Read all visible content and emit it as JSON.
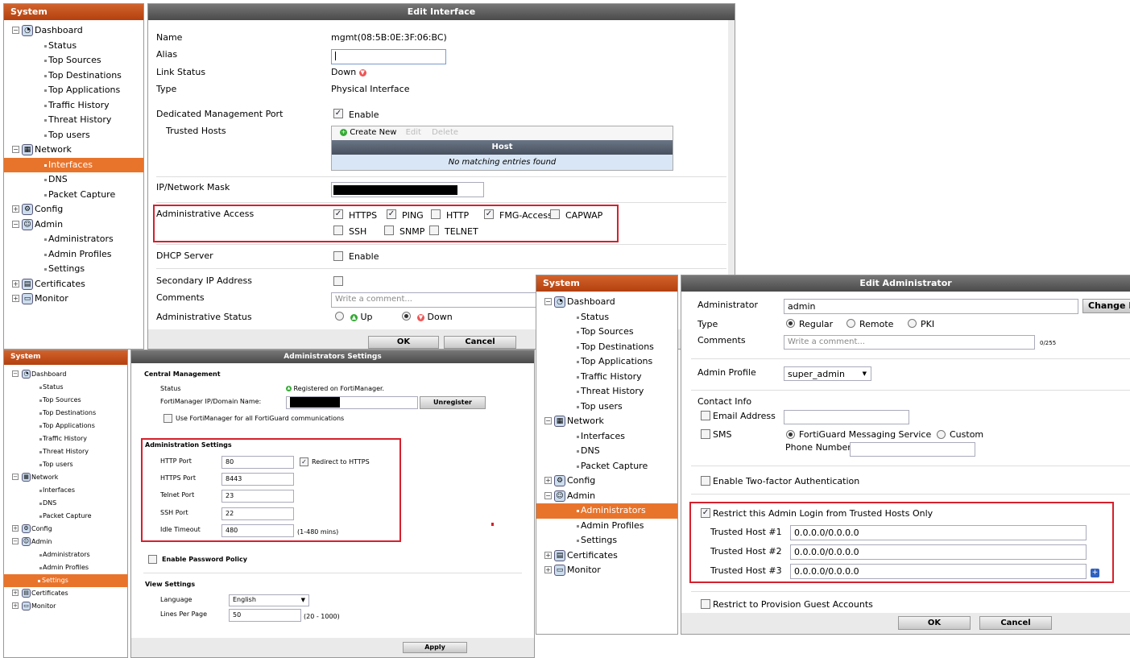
{
  "tree_main": {
    "title": "System",
    "items": [
      {
        "label": "Dashboard",
        "level": 1,
        "icon": "dashboard-icon",
        "glyph": "◔",
        "pm": "⊟"
      },
      {
        "label": "Status",
        "level": 2
      },
      {
        "label": "Top Sources",
        "level": 2
      },
      {
        "label": "Top Destinations",
        "level": 2
      },
      {
        "label": "Top Applications",
        "level": 2
      },
      {
        "label": "Traffic History",
        "level": 2
      },
      {
        "label": "Threat History",
        "level": 2
      },
      {
        "label": "Top users",
        "level": 2
      },
      {
        "label": "Network",
        "level": 1,
        "icon": "network-icon",
        "glyph": "▦",
        "pm": "⊟"
      },
      {
        "label": "Interfaces",
        "level": 2,
        "selected": true
      },
      {
        "label": "DNS",
        "level": 2
      },
      {
        "label": "Packet Capture",
        "level": 2
      },
      {
        "label": "Config",
        "level": 1,
        "icon": "config-icon",
        "glyph": "⚙",
        "pm": "⊞"
      },
      {
        "label": "Admin",
        "level": 1,
        "icon": "admin-icon",
        "glyph": "☺",
        "pm": "⊟"
      },
      {
        "label": "Administrators",
        "level": 2
      },
      {
        "label": "Admin Profiles",
        "level": 2
      },
      {
        "label": "Settings",
        "level": 2
      },
      {
        "label": "Certificates",
        "level": 1,
        "icon": "certificates-icon",
        "glyph": "▤",
        "pm": "⊞"
      },
      {
        "label": "Monitor",
        "level": 1,
        "icon": "monitor-icon",
        "glyph": "▭",
        "pm": "⊞"
      }
    ]
  },
  "tree_small": {
    "title": "System",
    "selected": "Settings"
  },
  "tree_right": {
    "title": "System",
    "selected": "Administrators"
  },
  "edit_interface": {
    "title": "Edit Interface",
    "name_label": "Name",
    "name_value": "mgmt(08:5B:0E:3F:06:BC)",
    "alias_label": "Alias",
    "link_status_label": "Link Status",
    "link_status_value": "Down",
    "type_label": "Type",
    "type_value": "Physical Interface",
    "dedicated_label": "Dedicated Management Port",
    "enable_label": "Enable",
    "trusted_hosts_label": "Trusted Hosts",
    "create_new": "Create New",
    "edit": "Edit",
    "delete": "Delete",
    "host_header": "Host",
    "no_entries": "No matching entries found",
    "ip_mask_label": "IP/Network Mask",
    "admin_access_label": "Administrative Access",
    "access": [
      {
        "label": "HTTPS",
        "checked": true
      },
      {
        "label": "PING",
        "checked": true
      },
      {
        "label": "HTTP",
        "checked": false
      },
      {
        "label": "FMG-Access",
        "checked": true
      },
      {
        "label": "CAPWAP",
        "checked": false
      },
      {
        "label": "SSH",
        "checked": false
      },
      {
        "label": "SNMP",
        "checked": false
      },
      {
        "label": "TELNET",
        "checked": false
      }
    ],
    "dhcp_label": "DHCP Server",
    "dhcp_enable": "Enable",
    "secondary_ip_label": "Secondary IP Address",
    "comments_label": "Comments",
    "comments_placeholder": "Write a comment...",
    "admin_status_label": "Administrative Status",
    "status_up": "Up",
    "status_down": "Down",
    "ok": "OK",
    "cancel": "Cancel"
  },
  "admin_settings": {
    "title": "Administrators Settings",
    "central_mgmt": "Central Management",
    "status_label": "Status",
    "status_value": "Registered on FortiManager.",
    "fmg_ip_label": "FortiManager IP/Domain Name:",
    "unregister": "Unregister",
    "use_fmg": "Use FortiManager for all FortiGuard communications",
    "admin_settings_title": "Administration Settings",
    "http_port_label": "HTTP Port",
    "http_port": "80",
    "redirect_https": "Redirect to HTTPS",
    "https_port_label": "HTTPS Port",
    "https_port": "8443",
    "telnet_port_label": "Telnet Port",
    "telnet_port": "23",
    "ssh_port_label": "SSH Port",
    "ssh_port": "22",
    "idle_timeout_label": "Idle Timeout",
    "idle_timeout": "480",
    "idle_range": "(1-480 mins)",
    "password_policy": "Enable Password Policy",
    "view_settings": "View Settings",
    "language_label": "Language",
    "language": "English",
    "lines_label": "Lines Per Page",
    "lines": "50",
    "lines_range": "(20 - 1000)",
    "apply": "Apply"
  },
  "edit_admin": {
    "title": "Edit Administrator",
    "admin_label": "Administrator",
    "admin_value": "admin",
    "change_btn": "Change P",
    "type_label": "Type",
    "type_regular": "Regular",
    "type_remote": "Remote",
    "type_pki": "PKI",
    "comments_label": "Comments",
    "comments_placeholder": "Write a comment...",
    "comments_count": "0/255",
    "profile_label": "Admin Profile",
    "profile_value": "super_admin",
    "contact_info": "Contact Info",
    "email_label": "Email Address",
    "sms_label": "SMS",
    "fortiguard_msg": "FortiGuard Messaging Service",
    "custom": "Custom",
    "phone_label": "Phone Number",
    "two_factor": "Enable Two-factor Authentication",
    "restrict_trusted": "Restrict this Admin Login from Trusted Hosts Only",
    "trusted": [
      {
        "label": "Trusted Host #1",
        "value": "0.0.0.0/0.0.0.0"
      },
      {
        "label": "Trusted Host #2",
        "value": "0.0.0.0/0.0.0.0"
      },
      {
        "label": "Trusted Host #3",
        "value": "0.0.0.0/0.0.0.0"
      }
    ],
    "restrict_guest": "Restrict to Provision Guest Accounts",
    "ok": "OK",
    "cancel": "Cancel"
  }
}
